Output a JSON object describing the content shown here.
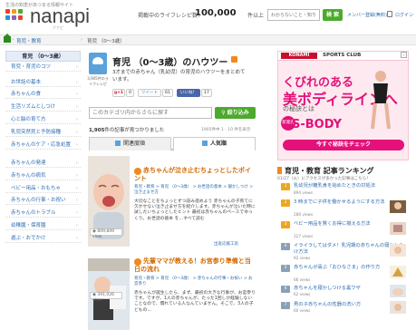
{
  "header": {
    "tagline": "生活の知恵があつまる情報サイト",
    "logo_text": "nanapi",
    "logo_sub": "ナナピ",
    "count_label": "掲載中のライフレシピ数：",
    "count_value": "100,000",
    "count_unit": "件以上",
    "search_placeholder": "わからないこと・知りたいことを入力",
    "search_button": "検 索",
    "register_link": "メンバー登録(無料)",
    "login_link": "ログイン",
    "logo_colors": [
      "#e8422a",
      "#f39a1d",
      "#4caa2c",
      "#2a8fd6",
      "#8b5fbf"
    ]
  },
  "breadcrumb": [
    "ナナピ",
    "育児・教育",
    "育児 （0～3歳）"
  ],
  "sidebar": {
    "heading": "育児 （0～3歳）",
    "items": [
      "育児・育児のコツ",
      "お世話の基本",
      "赤ちゃんの食",
      "生活リズムとしつけ",
      "心と脳の育て方",
      "乳児突然死と予防接種",
      "赤ちゃんのケア・応急処置",
      "赤ちゃんの発達",
      "赤ちゃんの病気",
      "ベビー用品・おもちゃ",
      "赤ちゃんの行事・お祝い",
      "赤ちゃんのトラブル",
      "幼稚園・保育園",
      "遊ぶ・おでかけ"
    ]
  },
  "category": {
    "icon_label": "3,905件のライフレシピ",
    "title": "育児 （0～3歳）のハウツー",
    "description": "3才までの赤ちゃん（乳幼児）の育児のハウツーをまとめています。",
    "social": {
      "gplus": "g+1",
      "gplus_count": "0",
      "tweet": "ツイート",
      "tweet_count": "61",
      "like": "いいね！",
      "like_count": "17"
    },
    "search_placeholder": "このカテゴリ内からさらに探す",
    "search_button": "絞り込み",
    "total_count": "1,905",
    "total_suffix": "件の記事が見つかりました",
    "pager": "1905件中 1 - 10 件を表示",
    "tabs": [
      "関連度順",
      "人気順"
    ]
  },
  "articles": [
    {
      "title": "赤ちゃんが泣き止むちょっとしたポイント",
      "crumb": "育児・教育 > 育児 （0～3歳） > お世話の基本 > 寝かしつけ > 泣き止ませ方",
      "body": "大切なことをちょっとずつ読み進めよう 赤ちゃんの子育てに欠かせない泣き止ませ方を紹介します。赤ちゃんが泣いた時に試したいちょっとしたヒント 最初は赤ちゃんのペースでゆっくり。お世話の基本 を…すべて読む",
      "views": "809,849",
      "views_unit": "view",
      "author": "出産応援工房"
    },
    {
      "title": "先輩ママが教える！お宮参り準備と当日の流れ",
      "crumb": "育児・教育 > 育児 （0～3歳） > 赤ちゃんの行事・お祝い > お宮参り",
      "body": "赤ちゃんが誕生したら、まず、最初の大きな行事が、お宮参りです。ですが、1人の赤ちゃんが、たった1回しか経験しないことなので、慣れている人なんていません。そこで、3人の子どもの…",
      "views": "391,026",
      "views_unit": "view",
      "author": ""
    }
  ],
  "ad": {
    "brand": "KONAMI",
    "club": "SPORTS CLUB",
    "line1": "くびれのある",
    "line2": "美ボディラインへ",
    "line3": "の秘訣とは",
    "new_tag": "新発売",
    "product": "S-BODY",
    "cta": "今すぐ秘訣をチェック",
    "choice": "i"
  },
  "ranking": {
    "heading": "育児・教育 記事ランキング",
    "subtitle": "01/27（火）にアクセスが多かった記事はこちら！",
    "items": [
      {
        "rank": "1",
        "title": "乳幼児が離乳食を始めたときの対処法",
        "views": "894 views"
      },
      {
        "rank": "2",
        "title": "3 時までに子供を働かせるようにする方法",
        "views": "286 views"
      },
      {
        "rank": "3",
        "title": "ベビー用品を賢くお得に揃える方法",
        "views": "227 views"
      },
      {
        "rank": "4",
        "title": "イライラしてはダメ！乳児期の赤ちゃんの寝かしつけ方法",
        "views": "92 views"
      },
      {
        "rank": "5",
        "title": "赤ちゃんが喜ぶ「おひなさま」の作り方",
        "views": "66 views"
      },
      {
        "rank": "6",
        "title": "赤ちゃんを寝かしつける裏ワザ",
        "views": "62 views"
      },
      {
        "rank": "7",
        "title": "男の子赤ちゃんの性器の洗い方",
        "views": "60 views"
      }
    ],
    "rank_colors": [
      "#f0a51e",
      "#f0a51e",
      "#f0a51e",
      "#8aa0b8",
      "#8aa0b8",
      "#8aa0b8",
      "#8aa0b8"
    ]
  }
}
